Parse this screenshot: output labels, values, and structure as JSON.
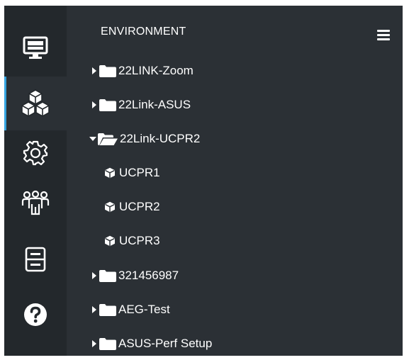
{
  "colors": {
    "rail_background": "#23282c",
    "panel_background": "#2b3035",
    "active_indicator": "#35a4e0",
    "text": "#ffffff"
  },
  "rail": {
    "items": [
      {
        "icon": "monitor-icon",
        "active": false
      },
      {
        "icon": "cubes-icon",
        "active": true
      },
      {
        "icon": "gear-icon",
        "active": false
      },
      {
        "icon": "users-icon",
        "active": false
      },
      {
        "icon": "cabinet-icon",
        "active": false
      },
      {
        "icon": "help-icon",
        "active": false
      }
    ]
  },
  "panel": {
    "title": "ENVIRONMENT",
    "menu_icon": "hamburger-icon"
  },
  "tree": [
    {
      "label": "22LINK-Zoom",
      "type": "folder",
      "expanded": false
    },
    {
      "label": "22Link-ASUS",
      "type": "folder",
      "expanded": false
    },
    {
      "label": "22Link-UCPR2",
      "type": "folder",
      "expanded": true
    },
    {
      "label": "UCPR1",
      "type": "device"
    },
    {
      "label": "UCPR2",
      "type": "device"
    },
    {
      "label": "UCPR3",
      "type": "device"
    },
    {
      "label": "321456987",
      "type": "folder",
      "expanded": false
    },
    {
      "label": "AEG-Test",
      "type": "folder",
      "expanded": false
    },
    {
      "label": "ASUS-Perf Setup",
      "type": "folder",
      "expanded": false
    }
  ]
}
